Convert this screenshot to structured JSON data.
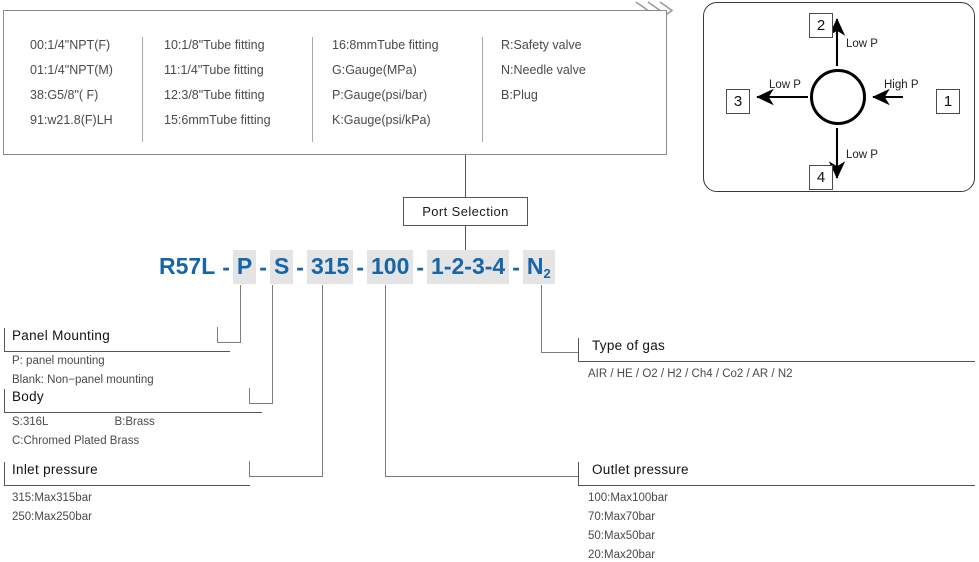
{
  "legend": {
    "columns": [
      {
        "items": [
          "00:1/4\"NPT(F)",
          "01:1/4\"NPT(M)",
          "38:G5/8\"( F)",
          "91:w21.8(F)LH"
        ]
      },
      {
        "items": [
          "10:1/8\"Tube fitting",
          "11:1/4\"Tube fitting",
          "12:3/8\"Tube fitting",
          "15:6mmTube fitting"
        ]
      },
      {
        "items": [
          "16:8mmTube fitting",
          "G:Gauge(MPa)",
          "P:Gauge(psi/bar)",
          "K:Gauge(psi/kPa)"
        ]
      },
      {
        "items": [
          "R:Safety valve",
          "N:Needle valve",
          "B:Plug"
        ]
      }
    ]
  },
  "port_diagram": {
    "ports": [
      {
        "id": "1",
        "label": "High P"
      },
      {
        "id": "2",
        "label": "Low P"
      },
      {
        "id": "3",
        "label": "Low P"
      },
      {
        "id": "4",
        "label": "Low P"
      }
    ]
  },
  "port_selection": {
    "label": "Port Selection"
  },
  "part_number": {
    "full": "R57L-P-S-315-100-1-2-3-4-N2",
    "segments": [
      {
        "text": "R57L",
        "highlight": false
      },
      {
        "text": "P",
        "highlight": true
      },
      {
        "text": "S",
        "highlight": true
      },
      {
        "text": "315",
        "highlight": true
      },
      {
        "text": "100",
        "highlight": true
      },
      {
        "text": "1-2-3-4",
        "highlight": true
      },
      {
        "text": "N",
        "sub": "2",
        "highlight": true
      }
    ],
    "separator": "-",
    "color": "#1565a8",
    "highlight_color": "#e4e4e4"
  },
  "callouts": {
    "panel_mounting": {
      "title": "Panel Mounting",
      "lines": [
        "P: panel mounting",
        "Blank: Non−panel mounting"
      ]
    },
    "body": {
      "title": "Body",
      "line1_a": "S:316L",
      "line1_b": "B:Brass",
      "line2": "C:Chromed Plated Brass"
    },
    "inlet_pressure": {
      "title": "Inlet pressure",
      "lines": [
        "315:Max315bar",
        "250:Max250bar"
      ]
    },
    "type_of_gas": {
      "title": "Type of gas",
      "lines": [
        "AIR / HE / O2 / H2 / Ch4 / Co2 / AR / N2"
      ]
    },
    "outlet_pressure": {
      "title": "Outlet pressure",
      "lines": [
        "100:Max100bar",
        "70:Max70bar",
        "50:Max50bar",
        "20:Max20bar"
      ]
    }
  }
}
